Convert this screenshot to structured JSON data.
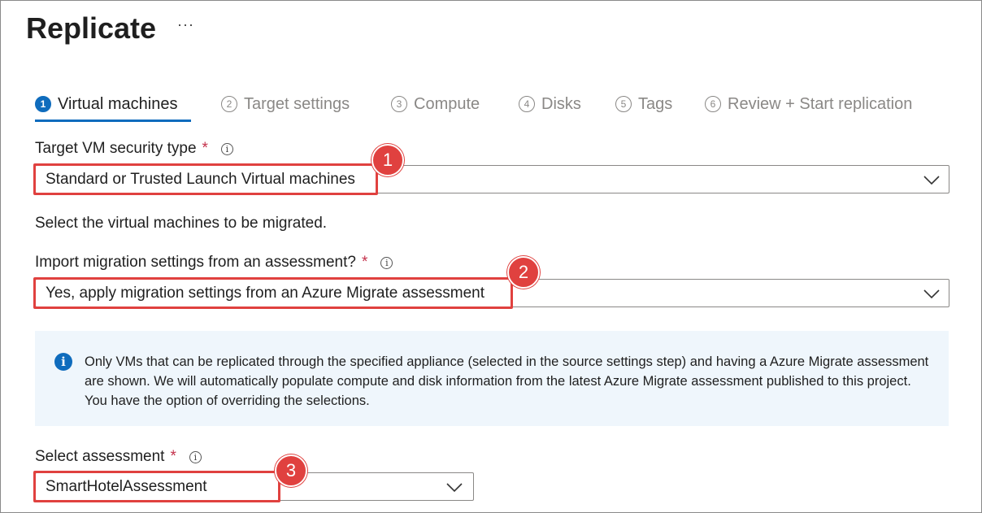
{
  "page": {
    "title": "Replicate",
    "more_label": "···"
  },
  "tabs": [
    {
      "num": "1",
      "label": "Virtual machines"
    },
    {
      "num": "2",
      "label": "Target settings"
    },
    {
      "num": "3",
      "label": "Compute"
    },
    {
      "num": "4",
      "label": "Disks"
    },
    {
      "num": "5",
      "label": "Tags"
    },
    {
      "num": "6",
      "label": "Review + Start replication"
    }
  ],
  "security_type": {
    "label": "Target VM security type",
    "required_mark": "*",
    "value": "Standard or Trusted Launch Virtual machines"
  },
  "select_vms_text": "Select the virtual machines to be migrated.",
  "import_settings": {
    "label": "Import migration settings from an assessment?",
    "required_mark": "*",
    "value": "Yes, apply migration settings from an Azure Migrate assessment"
  },
  "info_message": "Only VMs that can be replicated through the specified appliance (selected  in the source settings step) and having a Azure Migrate assessment are shown. We will automatically populate compute and disk information from the latest Azure Migrate assessment published to this project. You have the option of overriding the selections.",
  "assessment": {
    "label": "Select assessment",
    "required_mark": "*",
    "value": "SmartHotelAssessment"
  },
  "callouts": [
    "1",
    "2",
    "3"
  ],
  "icons": {
    "info_glyph": "i",
    "info_circle": "info-circle-icon",
    "chevron": "chevron-down-icon"
  },
  "colors": {
    "accent": "#0f6cbd",
    "required": "#c4314b",
    "callout": "#e0413f",
    "info_bg": "#eff6fc"
  }
}
